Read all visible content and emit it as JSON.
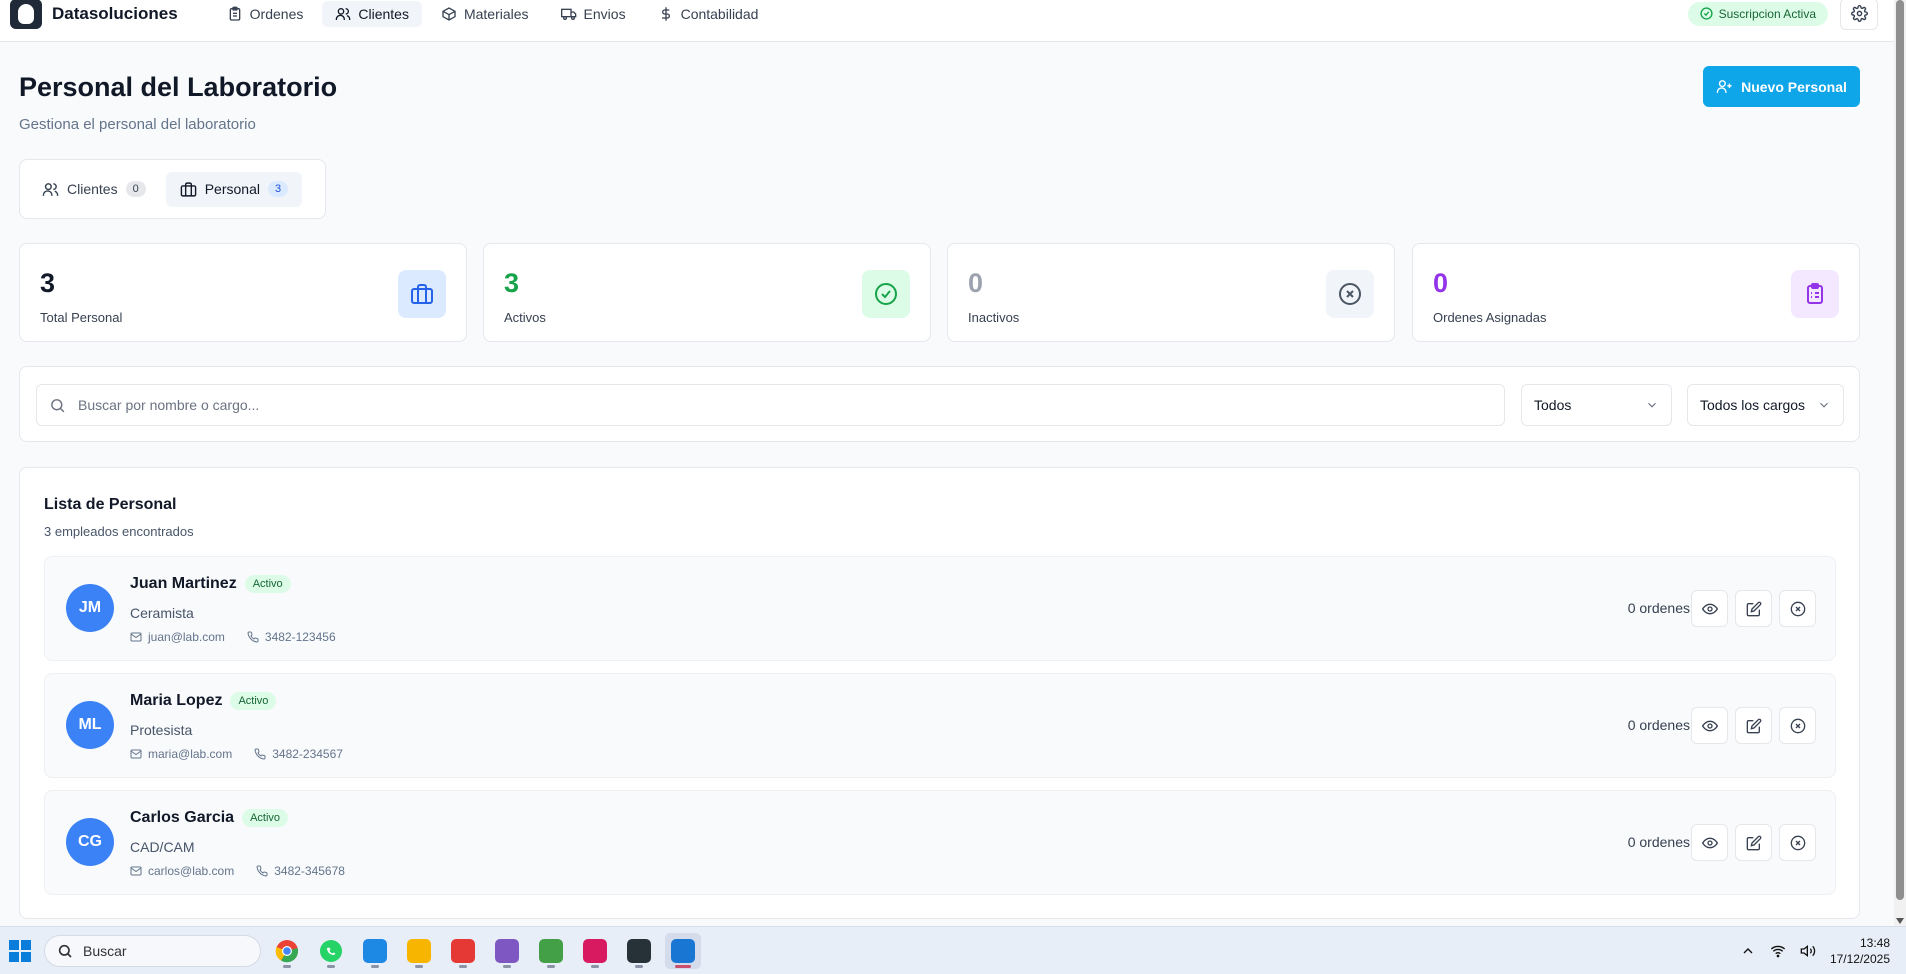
{
  "nav": {
    "brand": "Datasoluciones",
    "links": [
      {
        "label": "Ordenes",
        "icon": "clipboard-icon"
      },
      {
        "label": "Clientes",
        "icon": "users-icon"
      },
      {
        "label": "Materiales",
        "icon": "box-icon"
      },
      {
        "label": "Envios",
        "icon": "truck-icon"
      },
      {
        "label": "Contabilidad",
        "icon": "dollar-icon"
      }
    ],
    "active": "Clientes",
    "subscription": "Suscripcion Activa"
  },
  "header": {
    "title": "Personal del Laboratorio",
    "subtitle": "Gestiona el personal del laboratorio",
    "new_button": "Nuevo Personal"
  },
  "tabs": [
    {
      "label": "Clientes",
      "count": "0"
    },
    {
      "label": "Personal",
      "count": "3"
    }
  ],
  "stats": [
    {
      "value": "3",
      "label": "Total Personal",
      "color": "#111827",
      "icon": "briefcase-icon",
      "icon_bg": "#dbeafe",
      "icon_color": "#2563eb"
    },
    {
      "value": "3",
      "label": "Activos",
      "color": "#16a34a",
      "icon": "check-circle-icon",
      "icon_bg": "#dcfce7",
      "icon_color": "#16a34a"
    },
    {
      "value": "0",
      "label": "Inactivos",
      "color": "#9ca3af",
      "icon": "x-circle-icon",
      "icon_bg": "#f1f5f9",
      "icon_color": "#4b5563"
    },
    {
      "value": "0",
      "label": "Ordenes Asignadas",
      "color": "#9333ea",
      "icon": "clipboard-list-icon",
      "icon_bg": "#f3e8ff",
      "icon_color": "#9333ea"
    }
  ],
  "filters": {
    "search_placeholder": "Buscar por nombre o cargo...",
    "status_select": "Todos",
    "role_select": "Todos los cargos"
  },
  "list": {
    "title": "Lista de Personal",
    "subtitle": "3 empleados encontrados",
    "employees": [
      {
        "initials": "JM",
        "name": "Juan Martinez",
        "status": "Activo",
        "role": "Ceramista",
        "email": "juan@lab.com",
        "phone": "3482-123456",
        "orders": "0 ordenes"
      },
      {
        "initials": "ML",
        "name": "Maria Lopez",
        "status": "Activo",
        "role": "Protesista",
        "email": "maria@lab.com",
        "phone": "3482-234567",
        "orders": "0 ordenes"
      },
      {
        "initials": "CG",
        "name": "Carlos Garcia",
        "status": "Activo",
        "role": "CAD/CAM",
        "email": "carlos@lab.com",
        "phone": "3482-345678",
        "orders": "0 ordenes"
      }
    ]
  },
  "taskbar": {
    "search": "Buscar",
    "time": "13:48",
    "date": "17/12/2025"
  },
  "colors": {
    "accent": "#0ea5e9",
    "avatar": "#3b82f6",
    "active_badge": "#dcfce7"
  }
}
